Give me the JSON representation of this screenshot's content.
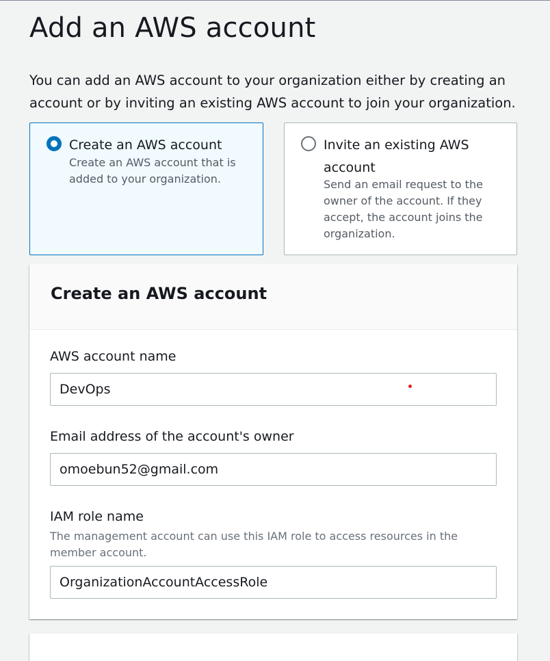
{
  "page": {
    "title": "Add an AWS account",
    "description": "You can add an AWS account to your organization either by creating an account or by inviting an existing AWS account to join your organization."
  },
  "options": {
    "selected": "create",
    "create": {
      "label": "Create an AWS account",
      "description": "Create an AWS account that is added to your organization."
    },
    "invite": {
      "label": "Invite an existing AWS account",
      "description": "Send an email request to the owner of the account. If they accept, the account joins the organization."
    }
  },
  "create_form": {
    "title": "Create an AWS account",
    "account_name": {
      "label": "AWS account name",
      "value": "DevOps"
    },
    "email": {
      "label": "Email address of the account's owner",
      "value": "omoebun52@gmail.com"
    },
    "iam_role": {
      "label": "IAM role name",
      "hint": "The management account can use this IAM role to access resources in the member account.",
      "value": "OrganizationAccountAccessRole"
    }
  },
  "colors": {
    "accent": "#0073bb",
    "selected_tile_bg": "#f1faff",
    "page_bg": "#f2f3f3"
  }
}
